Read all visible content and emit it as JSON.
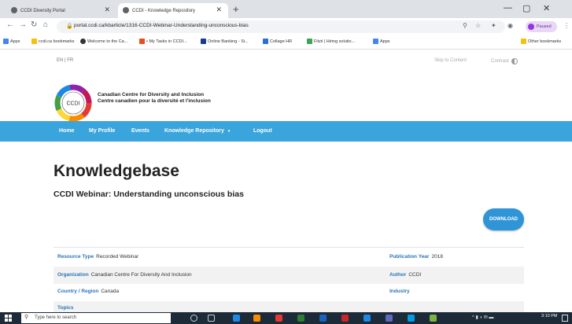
{
  "browser": {
    "tabs": [
      {
        "title": "CCDI Diversity Portal",
        "active": false
      },
      {
        "title": "CCDI - Knowledge Repository",
        "active": true
      }
    ],
    "url": "portal.ccdi.ca/kbarticle/1316-CCDI-Webinar-Understanding-unconscious-bias",
    "profile_label": "Paused",
    "bookmarks": [
      "Apps",
      "ccdi.ca bookmarks",
      "Welcome to the Ca...",
      "• My Tasks in CCDI...",
      "Online Banking - Si...",
      "Collage HR",
      "Fitzii | Hiring solutio...",
      "Apps",
      "Other bookmarks"
    ]
  },
  "header": {
    "lang": "EN | FR",
    "skip": "Skip to Content",
    "contrast": "Contrast",
    "org_en": "Canadian Centre for Diversity and Inclusion",
    "org_fr": "Centre canadien pour la diversité et l'inclusion",
    "logo_text": "CCDI"
  },
  "nav": {
    "items": [
      "Home",
      "My Profile",
      "Events",
      "Knowledge Repository",
      "Logout"
    ]
  },
  "main": {
    "title": "Knowledgebase",
    "subtitle": "CCDI Webinar: Understanding unconscious bias",
    "download": "DOWNLOAD",
    "rows": [
      {
        "l_label": "Resource Type",
        "l_value": "Recorded Webinar",
        "r_label": "Publication Year",
        "r_value": "2018"
      },
      {
        "l_label": "Organization",
        "l_value": "Canadian Centre For Diversity And Inclusion",
        "r_label": "Author",
        "r_value": "CCDI"
      },
      {
        "l_label": "Country / Region",
        "l_value": "Canada",
        "r_label": "Industry",
        "r_value": ""
      },
      {
        "l_label": "Topics",
        "l_value": "",
        "r_label": "",
        "r_value": ""
      }
    ]
  },
  "taskbar": {
    "search_placeholder": "Type here to search",
    "time": "3:10 PM"
  },
  "colors": {
    "nav": "#3aa4dc",
    "accent": "#2f95d6",
    "label": "#2b74b8"
  }
}
